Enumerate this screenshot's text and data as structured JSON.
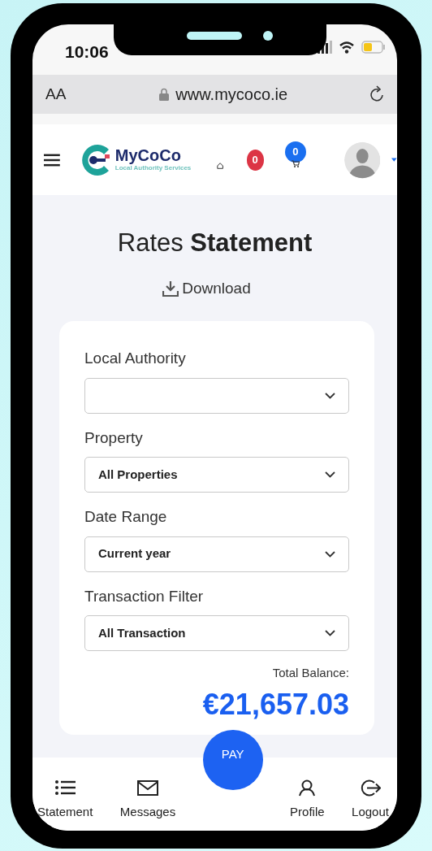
{
  "status_bar": {
    "time": "10:06"
  },
  "browser": {
    "text_size_button": "AA",
    "url": "www.mycoco.ie"
  },
  "header": {
    "logo": {
      "name": "MyCoCo",
      "tagline": "Local Authority Services"
    },
    "notifications_badge": "0",
    "cart_badge": "0"
  },
  "page": {
    "title": "Rates **Statement**",
    "download": "Download"
  },
  "filters": [
    {
      "label": "Local Authority"
    },
    {
      "label": "Property",
      "value": "All Properties"
    },
    {
      "label": "Date Range",
      "value": "Current year"
    },
    {
      "label": "Transaction Filter",
      "value": "All Transaction"
    }
  ],
  "total": {
    "label": "Total Balance:",
    "amount": "€21,657.03"
  },
  "bottom_nav": [
    {
      "kind": "link",
      "label": "Statement"
    },
    {
      "kind": "link",
      "label": "Messages"
    },
    {
      "kind": "action",
      "label": "PAY"
    },
    {
      "kind": "link",
      "label": "Profile"
    },
    {
      "kind": "link",
      "label": "Logout"
    }
  ]
}
